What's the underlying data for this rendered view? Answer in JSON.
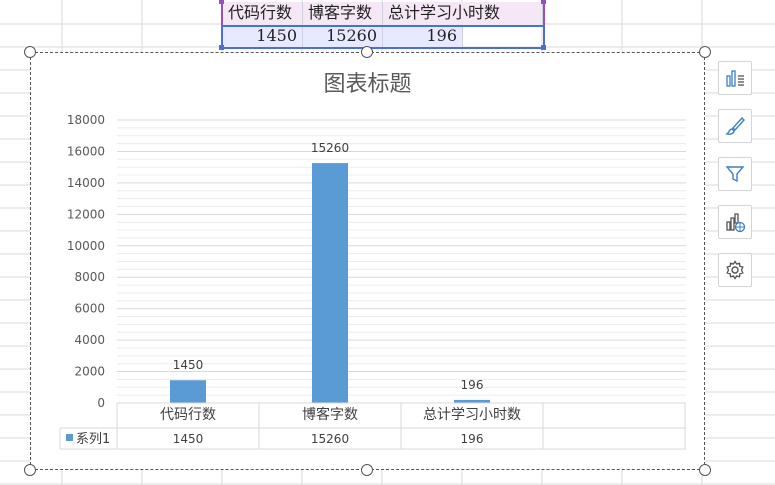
{
  "sheet": {
    "headers": [
      "代码行数",
      "博客字数",
      "总计学习小时数"
    ],
    "values": [
      "1450",
      "15260",
      "196"
    ]
  },
  "chart_data": {
    "type": "bar",
    "title": "图表标题",
    "categories": [
      "代码行数",
      "博客字数",
      "总计学习小时数"
    ],
    "series": [
      {
        "name": "系列1",
        "values": [
          1450,
          15260,
          196
        ]
      }
    ],
    "ylim": [
      0,
      18000
    ],
    "y_ticks": [
      0,
      2000,
      4000,
      6000,
      8000,
      10000,
      12000,
      14000,
      16000,
      18000
    ],
    "data_labels": true,
    "data_table": true,
    "legend": "data-table",
    "grid": true,
    "bar_color": "#5b9bd5"
  },
  "toolbar": {
    "icons": [
      "chart-elements-icon",
      "chart-style-icon",
      "chart-filter-icon",
      "chart-type-icon",
      "settings-icon"
    ]
  }
}
